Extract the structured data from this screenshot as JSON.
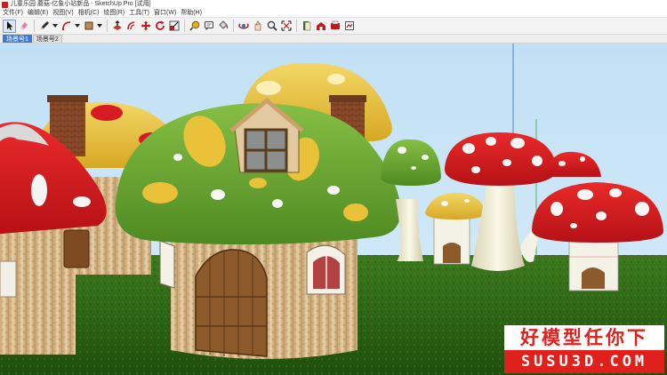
{
  "window": {
    "title": "儿童乐园 蘑菇-亿象小站新品 - SketchUp Pro [试用]"
  },
  "menu": {
    "items": [
      "文件(F)",
      "编辑(E)",
      "视图(V)",
      "相机(C)",
      "绘图(R)",
      "工具(T)",
      "窗口(W)",
      "帮助(H)"
    ]
  },
  "toolbar": {
    "tools": [
      {
        "icon": "select-arrow-icon",
        "active": true
      },
      {
        "icon": "eraser-icon"
      },
      {
        "icon": "pencil-icon",
        "dropdown": true
      },
      {
        "icon": "arc-icon",
        "dropdown": true
      },
      {
        "icon": "rectangle-icon",
        "dropdown": true
      },
      {
        "icon": "push-pull-icon"
      },
      {
        "icon": "offset-icon"
      },
      {
        "icon": "move-icon"
      },
      {
        "icon": "rotate-icon"
      },
      {
        "icon": "scale-icon"
      },
      {
        "icon": "tape-measure-icon"
      },
      {
        "icon": "text-icon"
      },
      {
        "icon": "paint-bucket-icon"
      },
      {
        "icon": "orbit-icon"
      },
      {
        "icon": "pan-icon"
      },
      {
        "icon": "zoom-icon"
      },
      {
        "icon": "zoom-extents-icon"
      },
      {
        "icon": "components-icon"
      },
      {
        "icon": "warehouse-icon"
      },
      {
        "icon": "extension-icon"
      },
      {
        "icon": "layout-icon"
      }
    ]
  },
  "scenes": {
    "tabs": [
      {
        "label": "场景号1",
        "active": true
      },
      {
        "label": "场景号2",
        "active": false
      }
    ]
  },
  "watermark": {
    "line1": "好模型任你下",
    "line2": "SUSU3D.COM"
  },
  "colors": {
    "sky": "#c6e3f6",
    "grass": "#2d6a15",
    "cap_red": "#d61c22",
    "cap_green": "#6ea532",
    "cap_yellow": "#e8c13d",
    "stone": "#d9b98a",
    "door": "#8d5a2b",
    "watermark_red": "#e0201a"
  }
}
